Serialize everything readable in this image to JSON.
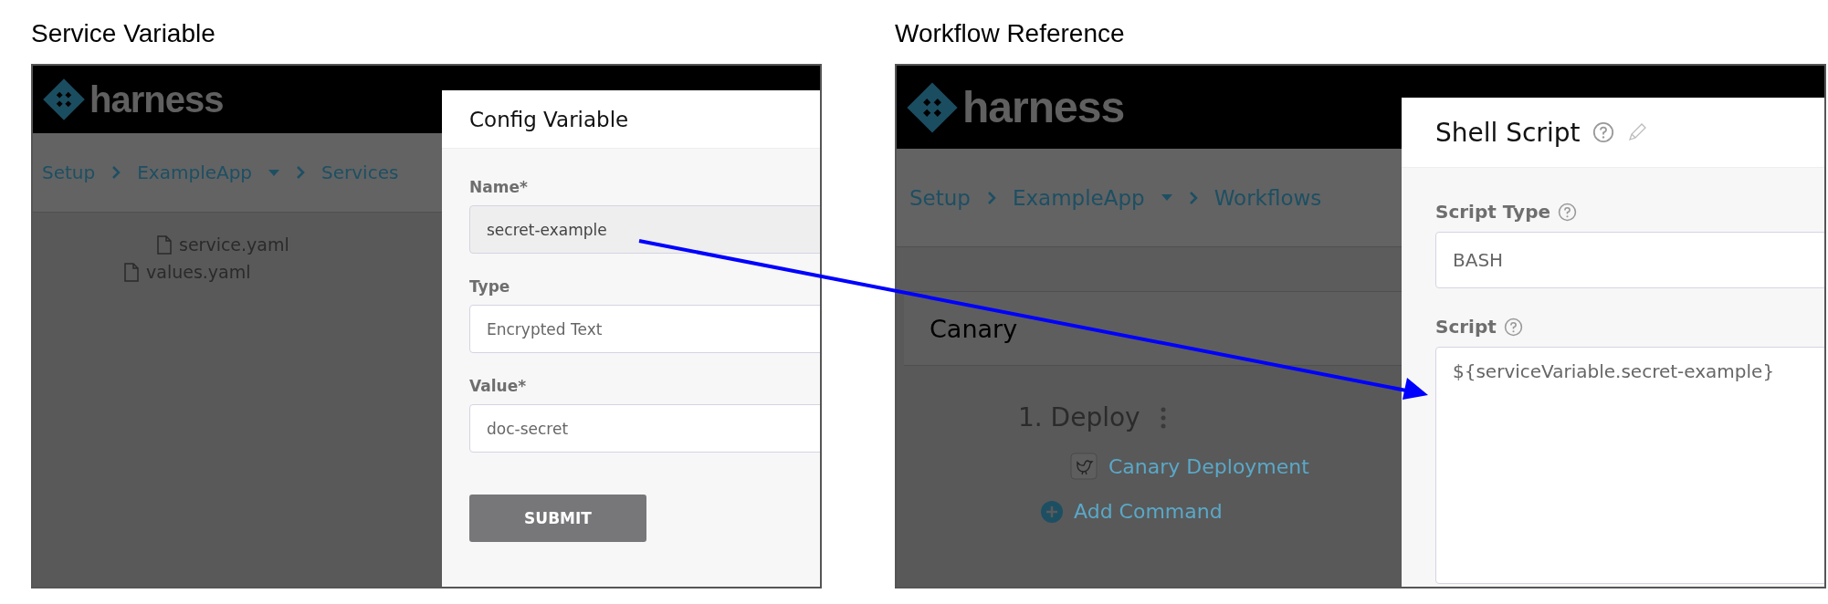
{
  "figures": [
    {
      "caption": "Service Variable",
      "logo": "harness",
      "breadcrumb": [
        {
          "label": "Setup",
          "dropdown": false
        },
        {
          "label": "ExampleApp",
          "dropdown": true
        },
        {
          "label": "Services",
          "dropdown": false
        }
      ],
      "tree": [
        {
          "children": [
            {
              "label": "service.yaml"
            }
          ]
        },
        {
          "label": "values.yaml"
        }
      ],
      "dialog": {
        "title": "Config Variable",
        "help": false,
        "editable": false,
        "fields": [
          {
            "label": "Name*",
            "value": "secret-example",
            "kind": "input",
            "disabled": true,
            "help": false
          },
          {
            "label": "Type",
            "value": "Encrypted Text",
            "kind": "input",
            "disabled": false,
            "help": false
          },
          {
            "label": "Value*",
            "value": "doc-secret",
            "kind": "input",
            "disabled": false,
            "help": false
          }
        ],
        "button": "SUBMIT"
      }
    },
    {
      "caption": "Workflow Reference",
      "logo": "harness",
      "breadcrumb": [
        {
          "label": "Setup",
          "dropdown": false
        },
        {
          "label": "ExampleApp",
          "dropdown": true
        },
        {
          "label": "Workflows",
          "dropdown": false
        }
      ],
      "workflow": {
        "section": "Canary",
        "step": "1. Deploy",
        "command": "Canary Deployment",
        "add": "Add Command"
      },
      "dialog": {
        "title": "Shell Script",
        "help": true,
        "editable": true,
        "fields": [
          {
            "label": "Script Type",
            "value": "BASH",
            "kind": "input",
            "disabled": false,
            "help": true
          },
          {
            "label": "Script",
            "value": "${serviceVariable.secret-example}",
            "kind": "textarea",
            "disabled": false,
            "help": true
          }
        ]
      }
    }
  ]
}
